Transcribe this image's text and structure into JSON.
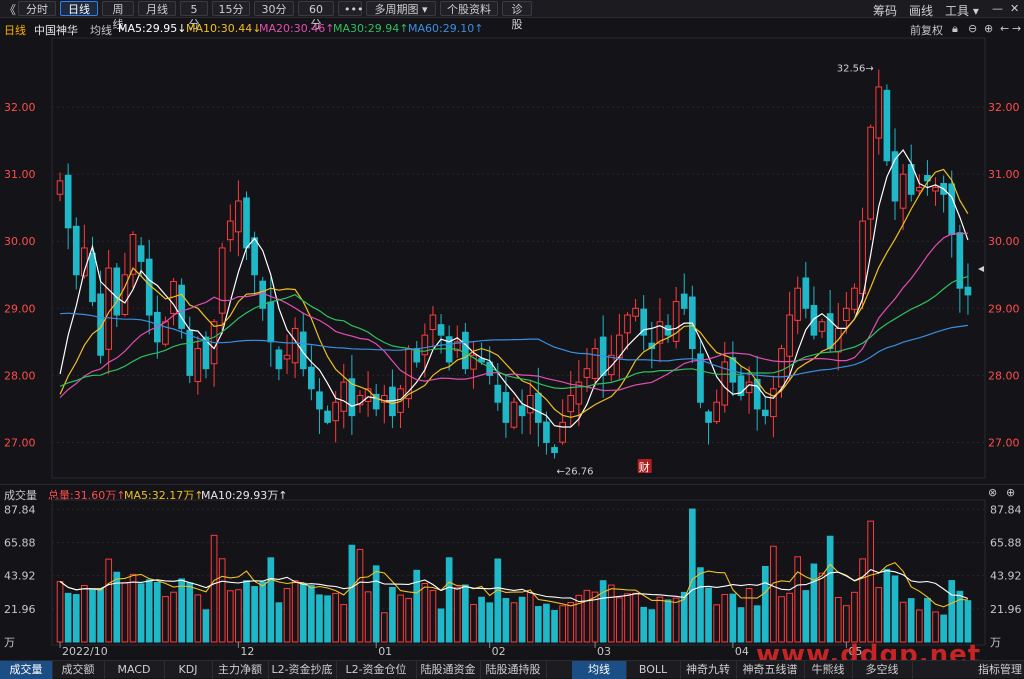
{
  "toolbar": {
    "back": "《",
    "periods": [
      "分时",
      "日线",
      "周线",
      "月线",
      "5分",
      "15分",
      "30分",
      "60分",
      "•••",
      "多周期图 ▾",
      "个股资料",
      "诊股"
    ],
    "active_index": 1,
    "right_items": [
      "筹码",
      "画线",
      "工具 ▾"
    ]
  },
  "header": {
    "period": "日线",
    "name": "中国神华",
    "ma_title": "均线",
    "ma_labels": [
      {
        "text": "MA5:29.95↓",
        "color": "#ffffff"
      },
      {
        "text": "MA10:30.44↓",
        "color": "#f0c020"
      },
      {
        "text": "MA20:30.46↑",
        "color": "#e04fb0"
      },
      {
        "text": "MA30:29.94↑",
        "color": "#2fbf5f"
      },
      {
        "text": "MA60:29.10↑",
        "color": "#3a8fe0"
      }
    ],
    "adjust": "前复权"
  },
  "volume_header": {
    "title": "成交量",
    "total": "总量:31.60万↑",
    "ma5": "MA5:32.17万↑",
    "ma10": "MA10:29.93万↑"
  },
  "bottom_tabs": [
    "成交量",
    "成交额",
    "MACD",
    "KDJ",
    "主力净额",
    "L2-资金抄底",
    "L2-资金仓位",
    "陆股通资金",
    "陆股通持股"
  ],
  "bottom_right_tabs": [
    "均线",
    "BOLL",
    "神奇九转",
    "神奇五线谱",
    "牛熊线",
    "多空线"
  ],
  "bottom_last": "指标管理",
  "watermark": "www.ddgp.net",
  "fin_badge": "财",
  "price_max_label": "32.56→",
  "price_min_label": "←26.76",
  "colors": {
    "up": "#ff3b3b",
    "down": "#1fb8c8",
    "ma5": "#ffffff",
    "ma10": "#f0c020",
    "ma20": "#e04fb0",
    "ma30": "#2fbf5f",
    "ma60": "#3a8fe0",
    "price_axis": "#ff4d4d"
  },
  "chart_data": {
    "type": "candlestick",
    "price_ticks": [
      "32.00",
      "31.00",
      "30.00",
      "29.00",
      "28.00",
      "27.00"
    ],
    "price_tick_values": [
      32,
      31,
      30,
      29,
      28,
      27
    ],
    "ylim": [
      26.5,
      33.0
    ],
    "volume_ticks": [
      "87.84",
      "65.88",
      "43.92",
      "21.96",
      "万"
    ],
    "volume_tick_values": [
      87.84,
      65.88,
      43.92,
      21.96,
      0
    ],
    "volume_ylim": [
      0,
      92
    ],
    "month_labels": [
      {
        "text": "2022/10",
        "index": 0
      },
      {
        "text": "12",
        "index": 22
      },
      {
        "text": "01",
        "index": 39
      },
      {
        "text": "02",
        "index": 53
      },
      {
        "text": "03",
        "index": 66
      },
      {
        "text": "04",
        "index": 83
      },
      {
        "text": "05",
        "index": 97
      }
    ],
    "max_point": {
      "value": 32.56,
      "index": 101
    },
    "min_point": {
      "value": 26.76,
      "index": 61
    },
    "closes": [
      30.9,
      30.2,
      29.5,
      29.9,
      29.1,
      28.3,
      29.6,
      28.9,
      29.5,
      30.1,
      29.7,
      28.9,
      28.5,
      28.8,
      29.4,
      28.7,
      28.0,
      28.4,
      28.1,
      28.8,
      29.9,
      30.3,
      30.6,
      29.9,
      29.5,
      29.0,
      28.5,
      28.1,
      28.3,
      28.7,
      28.1,
      27.8,
      27.5,
      27.3,
      27.6,
      27.9,
      27.4,
      27.7,
      27.8,
      27.5,
      27.7,
      27.4,
      27.8,
      28.4,
      28.2,
      28.6,
      28.9,
      28.6,
      28.2,
      28.5,
      28.1,
      28.3,
      28.2,
      28.0,
      27.6,
      27.3,
      27.6,
      27.4,
      27.7,
      27.3,
      27.0,
      26.85,
      27.3,
      27.7,
      27.9,
      28.1,
      28.4,
      28.0,
      28.3,
      28.6,
      28.9,
      29.0,
      28.6,
      28.4,
      28.8,
      28.6,
      29.1,
      29.0,
      28.4,
      27.6,
      27.3,
      27.6,
      28.2,
      27.9,
      27.7,
      27.9,
      27.5,
      27.4,
      27.8,
      28.4,
      28.9,
      29.3,
      29.0,
      28.6,
      28.8,
      28.4,
      28.7,
      29.0,
      29.3,
      30.3,
      31.7,
      32.3,
      31.2,
      30.6,
      31.0,
      30.7,
      30.8,
      30.9,
      30.8,
      30.7,
      30.1,
      29.3,
      29.2
    ]
  }
}
